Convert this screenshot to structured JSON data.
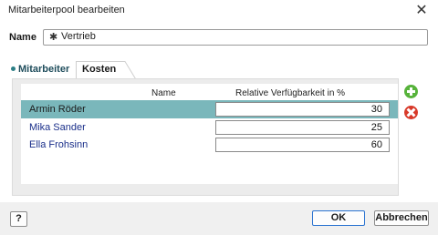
{
  "dialog": {
    "title": "Mitarbeiterpool bearbeiten",
    "close_glyph": "✕"
  },
  "name_field": {
    "label": "Name",
    "icon": "✱",
    "value": "Vertrieb"
  },
  "tabs": [
    {
      "label": "Mitarbeiter",
      "active": false
    },
    {
      "label": "Kosten",
      "active": true
    }
  ],
  "table": {
    "columns": [
      "Name",
      "Relative Verfügbarkeit in %"
    ],
    "rows": [
      {
        "name": "Armin Röder",
        "value": "30",
        "selected": true
      },
      {
        "name": "Mika Sander",
        "value": "25",
        "selected": false
      },
      {
        "name": "Ella Frohsinn",
        "value": "60",
        "selected": false
      }
    ]
  },
  "icons": {
    "add": "plus-circle-icon",
    "delete": "x-circle-icon"
  },
  "colors": {
    "selected_row": "#7ab7bb",
    "name_link": "#1a2f8a",
    "add": "#57b33b",
    "delete": "#d83a2a",
    "ok_border": "#2a73d1"
  },
  "footer": {
    "help_label": "?",
    "ok_label": "OK",
    "cancel_label": "Abbrechen"
  }
}
